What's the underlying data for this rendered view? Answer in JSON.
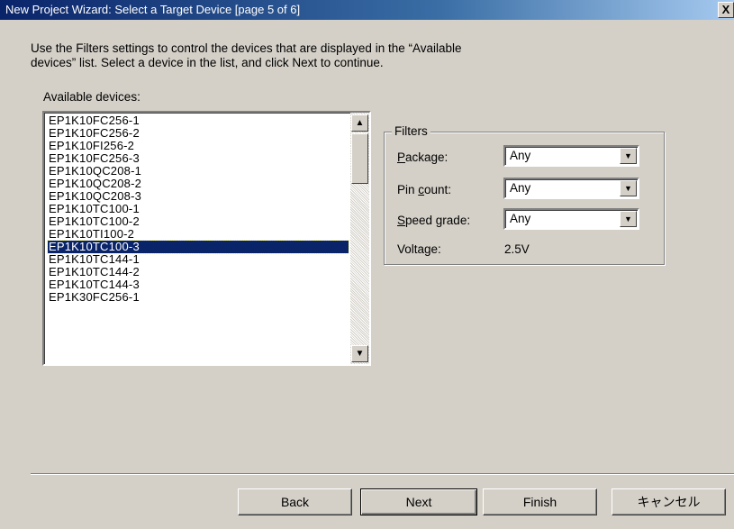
{
  "window": {
    "title": "New Project Wizard: Select a Target Device [page 5 of 6]",
    "close_label": "X"
  },
  "instructions": {
    "line1": "Use the Filters settings to control the devices that are displayed in the “Available",
    "line2": "devices” list.  Select a device in the list, and click Next to continue."
  },
  "devices": {
    "label": "Available devices:",
    "selected_index": 10,
    "items": [
      "EP1K10FC256-1",
      "EP1K10FC256-2",
      "EP1K10FI256-2",
      "EP1K10FC256-3",
      "EP1K10QC208-1",
      "EP1K10QC208-2",
      "EP1K10QC208-3",
      "EP1K10TC100-1",
      "EP1K10TC100-2",
      "EP1K10TI100-2",
      "EP1K10TC100-3",
      "EP1K10TC144-1",
      "EP1K10TC144-2",
      "EP1K10TC144-3",
      "EP1K30FC256-1"
    ]
  },
  "filters": {
    "legend": "Filters",
    "package": {
      "mnemonic": "P",
      "rest": "ackage:",
      "value": "Any"
    },
    "pin_count": {
      "pre": "Pin ",
      "mnemonic": "c",
      "rest": "ount:",
      "value": "Any"
    },
    "speed_grade": {
      "mnemonic": "S",
      "rest": "peed grade:",
      "value": "Any"
    },
    "voltage": {
      "label": "Voltage:",
      "value": "2.5V"
    }
  },
  "buttons": {
    "back": "Back",
    "next": "Next",
    "finish": "Finish",
    "cancel": "キャンセル"
  },
  "icons": {
    "up": "scroll-up-arrow-icon",
    "down": "scroll-down-arrow-icon",
    "dropdown": "chevron-down-icon"
  }
}
